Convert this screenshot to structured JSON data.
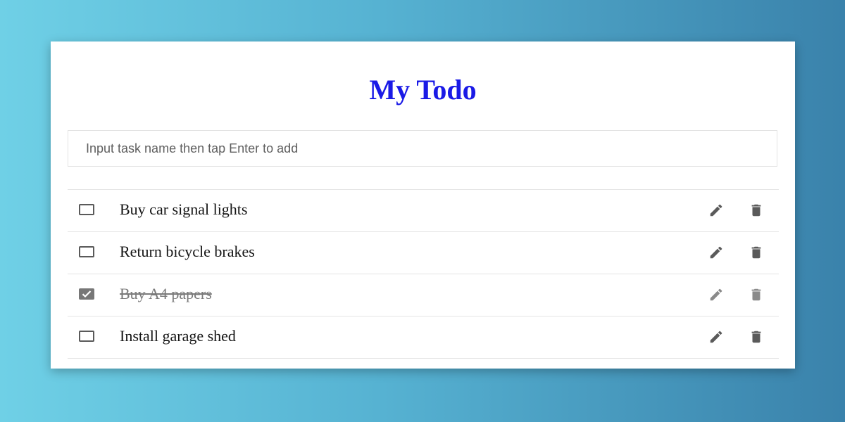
{
  "app": {
    "title": "My Todo"
  },
  "add_task": {
    "placeholder": "Input task name then tap Enter to add",
    "value": ""
  },
  "tasks": [
    {
      "name": "Buy car signal lights",
      "completed": false
    },
    {
      "name": "Return bicycle brakes",
      "completed": false
    },
    {
      "name": "Buy A4 papers",
      "completed": true
    },
    {
      "name": "Install garage shed",
      "completed": false
    }
  ],
  "icons": {
    "edit": "pencil-icon",
    "delete": "trash-icon",
    "checked": "checkmark-icon"
  },
  "colors": {
    "title": "#1a1ae6",
    "background_start": "#6fd0e6",
    "background_end": "#3a82ab",
    "icon_active": "#5a5a5a",
    "icon_done": "#8a8a8a"
  }
}
